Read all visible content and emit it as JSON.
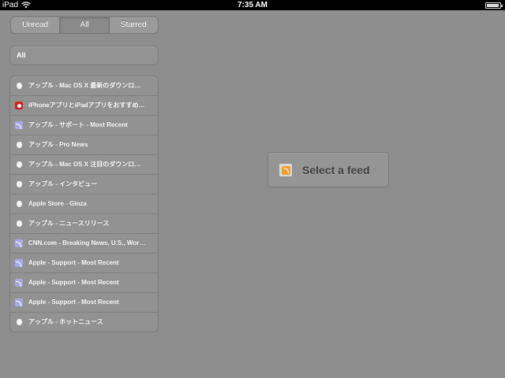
{
  "status_bar": {
    "device": "iPad",
    "time": "7:35 AM"
  },
  "filter": {
    "segments": [
      "Unread",
      "All",
      "Starred"
    ],
    "selected": "All"
  },
  "group": {
    "label": "All"
  },
  "feeds": [
    {
      "label": "アップル - Mac OS X 最新のダウンロ…",
      "icon": "apple-icon"
    },
    {
      "label": "iPhoneアプリとiPadアプリをおすすめ…",
      "icon": "app-icon"
    },
    {
      "label": "アップル - サポート - Most Recent",
      "icon": "rss-icon"
    },
    {
      "label": "アップル - Pro News",
      "icon": "apple-icon"
    },
    {
      "label": "アップル - Mac OS X 注目のダウンロ…",
      "icon": "apple-icon"
    },
    {
      "label": "アップル - インタビュー",
      "icon": "apple-icon"
    },
    {
      "label": "Apple Store - Ginza",
      "icon": "apple-icon"
    },
    {
      "label": "アップル - ニュースリリース",
      "icon": "apple-icon"
    },
    {
      "label": "CNN.com - Breaking News, U.S., Wor…",
      "icon": "rss-icon"
    },
    {
      "label": "Apple - Support - Most Recent",
      "icon": "rss-icon"
    },
    {
      "label": "Apple - Support - Most Recent",
      "icon": "rss-icon"
    },
    {
      "label": "Apple - Support - Most Recent",
      "icon": "rss-icon"
    },
    {
      "label": "アップル - ホットニュース",
      "icon": "apple-icon"
    }
  ],
  "detail": {
    "empty_label": "Select a feed",
    "icon": "rss-feed-icon"
  },
  "colors": {
    "background": "#8e8e8e",
    "status_bar": "#000000",
    "rss_icon": "#a7a7e6",
    "app_icon": "#d62020",
    "feed_icon_accent": "#f0a030"
  }
}
